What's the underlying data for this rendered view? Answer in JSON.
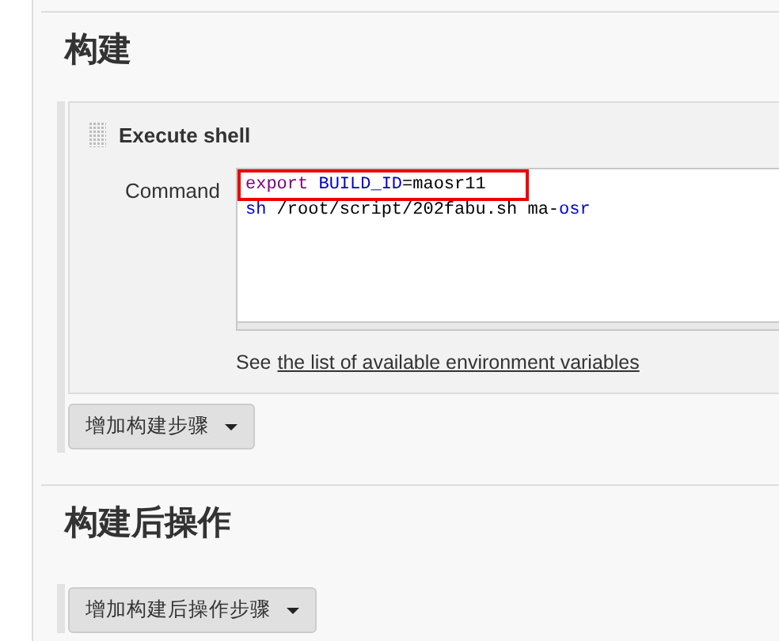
{
  "sections": [
    {
      "title": "构建",
      "steps": [
        {
          "title": "Execute shell",
          "command_label": "Command",
          "command_lines": [
            {
              "highlighted": true,
              "tokens": [
                {
                  "kind": "keyword",
                  "text": "export"
                },
                {
                  "kind": "variable",
                  "text": "BUILD_ID",
                  "gap_before": true
                },
                {
                  "kind": "plain",
                  "text": "=maosr11"
                }
              ]
            },
            {
              "highlighted": false,
              "tokens": [
                {
                  "kind": "variable",
                  "text": "sh"
                },
                {
                  "kind": "plain",
                  "text": " /root/script/202fabu.sh ma-"
                },
                {
                  "kind": "variable",
                  "text": "osr"
                }
              ]
            }
          ],
          "help_prefix": "See",
          "help_link": "the list of available environment variables"
        }
      ],
      "add_button": "增加构建步骤"
    },
    {
      "title": "构建后操作",
      "add_button": "增加构建后操作步骤"
    }
  ]
}
